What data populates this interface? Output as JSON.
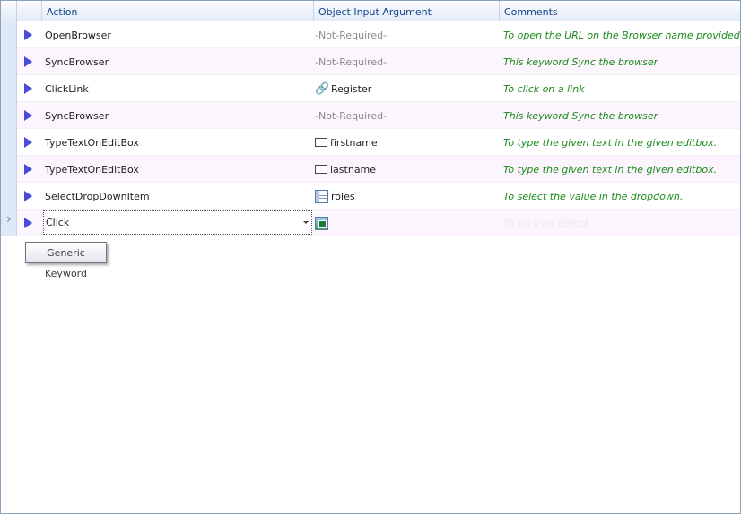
{
  "columns": {
    "action": "Action",
    "object_input_argument": "Object Input Argument",
    "comments": "Comments"
  },
  "rows": [
    {
      "action": "OpenBrowser",
      "arg": "-Not-Required-",
      "arg_icon": "none",
      "comment": "To open the URL on the Browser name provided"
    },
    {
      "action": "SyncBrowser",
      "arg": "-Not-Required-",
      "arg_icon": "none",
      "comment": "This keyword Sync the browser"
    },
    {
      "action": "ClickLink",
      "arg": "Register",
      "arg_icon": "link-icon",
      "comment": "To click on a link"
    },
    {
      "action": "SyncBrowser",
      "arg": "-Not-Required-",
      "arg_icon": "none",
      "comment": "This keyword Sync the browser"
    },
    {
      "action": "TypeTextOnEditBox",
      "arg": "firstname",
      "arg_icon": "editbox-icon",
      "comment": "To type the given text in the given editbox."
    },
    {
      "action": "TypeTextOnEditBox",
      "arg": "lastname",
      "arg_icon": "editbox-icon",
      "comment": "To type the given text in the given editbox."
    },
    {
      "action": "SelectDropDownItem",
      "arg": "roles",
      "arg_icon": "listbox-icon",
      "comment": "To select the value in the dropdown."
    }
  ],
  "editing_row": {
    "action": "Click",
    "arg": "",
    "arg_icon": "image-icon",
    "comment": "To click on object"
  },
  "tooltip": "Generic Keyword",
  "colors": {
    "header_text": "#15428b",
    "comment_text": "#1a8a1a",
    "play_icon": "#4b4bd8",
    "alt_row": "#fcf5fd"
  }
}
